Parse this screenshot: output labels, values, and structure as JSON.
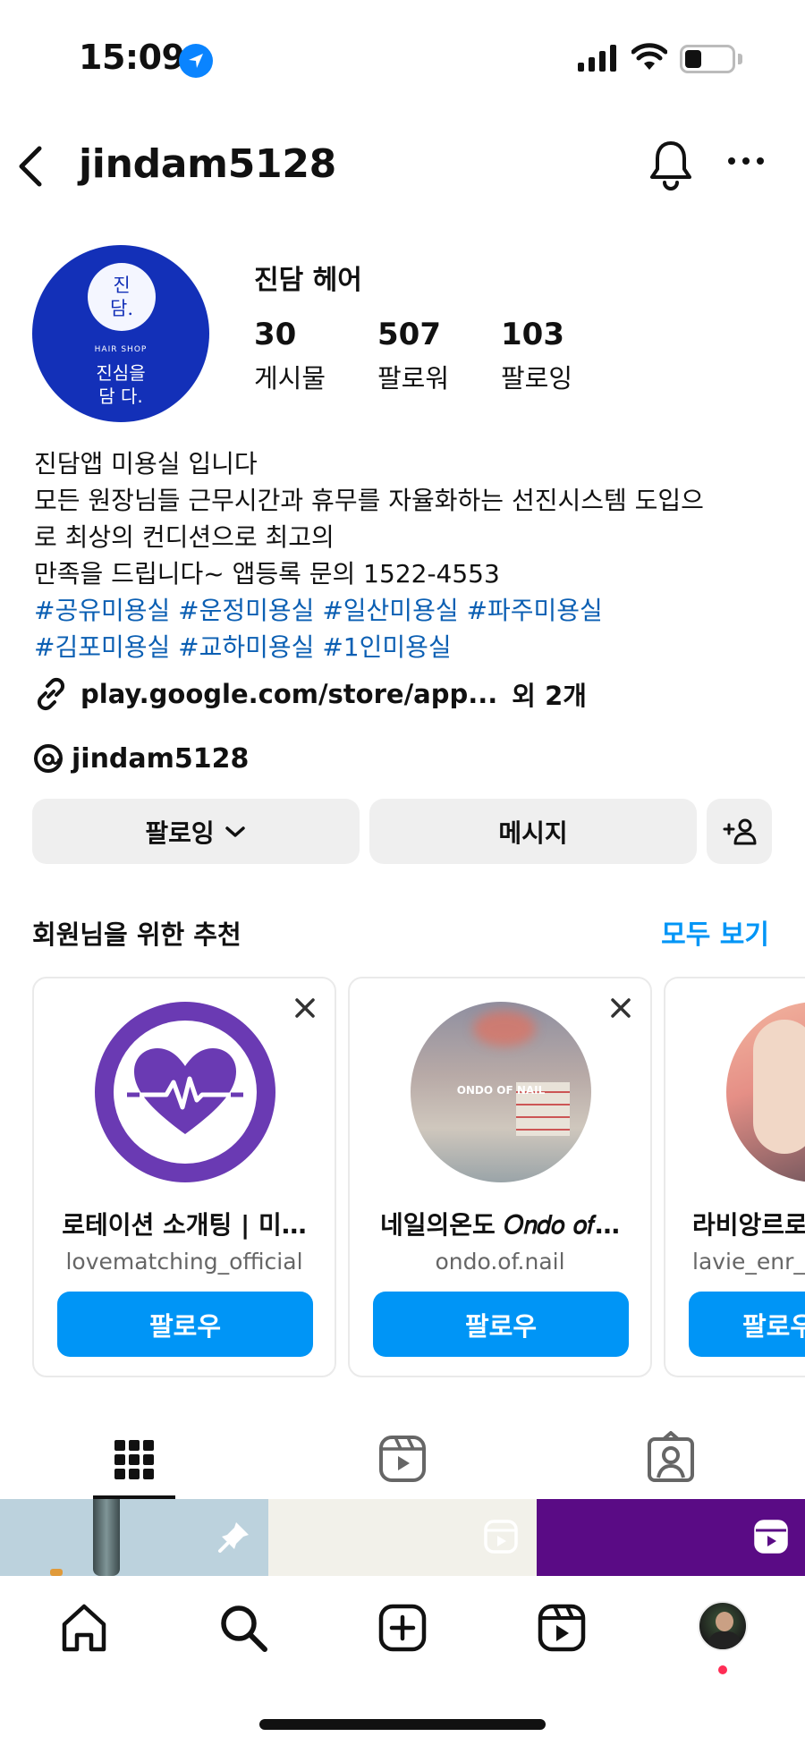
{
  "status": {
    "time": "15:09"
  },
  "header": {
    "username": "jindam5128"
  },
  "profile": {
    "avatar_logo": {
      "char_top": "진",
      "char_bottom": "담.",
      "shop_label": "HAIR SHOP",
      "slogan_line1": "진심을",
      "slogan_line2": "담 다."
    },
    "display_name": "진담 헤어",
    "stats": [
      {
        "value": "30",
        "label": "게시물"
      },
      {
        "value": "507",
        "label": "팔로워"
      },
      {
        "value": "103",
        "label": "팔로잉"
      }
    ],
    "bio_lines": [
      "진담앱 미용실 입니다",
      "모든 원장님들 근무시간과 휴무를 자율화하는 선진시스템 도입으",
      "로 최상의 컨디션으로 최고의",
      "만족을 드립니다~ 앱등록 문의 1522-4553"
    ],
    "hashtag_lines": [
      "#공유미용실 #운정미용실 #일산미용실 #파주미용실",
      "#김포미용실 #교하미용실 #1인미용실"
    ],
    "link_text": "play.google.com/store/app...",
    "link_extra": "외 2개",
    "threads_handle": "jindam5128"
  },
  "actions": {
    "following_label": "팔로잉",
    "message_label": "메시지"
  },
  "recommendations": {
    "title": "회원님을 위한 추천",
    "see_all": "모두 보기",
    "cards": [
      {
        "name": "로테이션 소개팅 | 미…",
        "handle": "lovematching_official",
        "follow_label": "팔로우",
        "image_text": ""
      },
      {
        "name": "네일의온도 𝑂𝑛𝑑𝑜 𝑜𝑓…",
        "handle": "ondo.of.nail",
        "follow_label": "팔로우",
        "image_text": "ONDO OF NAIL"
      },
      {
        "name": "라비앙르로",
        "handle": "lavie_enr_",
        "follow_label": "팔로우",
        "image_text": ""
      }
    ]
  },
  "colors": {
    "accent": "#0095f6",
    "hashtag": "#0b5fb3",
    "brand_blue": "#1330b8",
    "heart_purple": "#6a3ab3"
  },
  "icons": [
    "back-arrow-icon",
    "bell-icon",
    "more-icon",
    "link-icon",
    "threads-icon",
    "chevron-down-icon",
    "add-person-icon",
    "close-icon",
    "grid-icon",
    "reels-icon",
    "tagged-icon",
    "pin-icon",
    "home-icon",
    "search-icon",
    "create-icon"
  ]
}
